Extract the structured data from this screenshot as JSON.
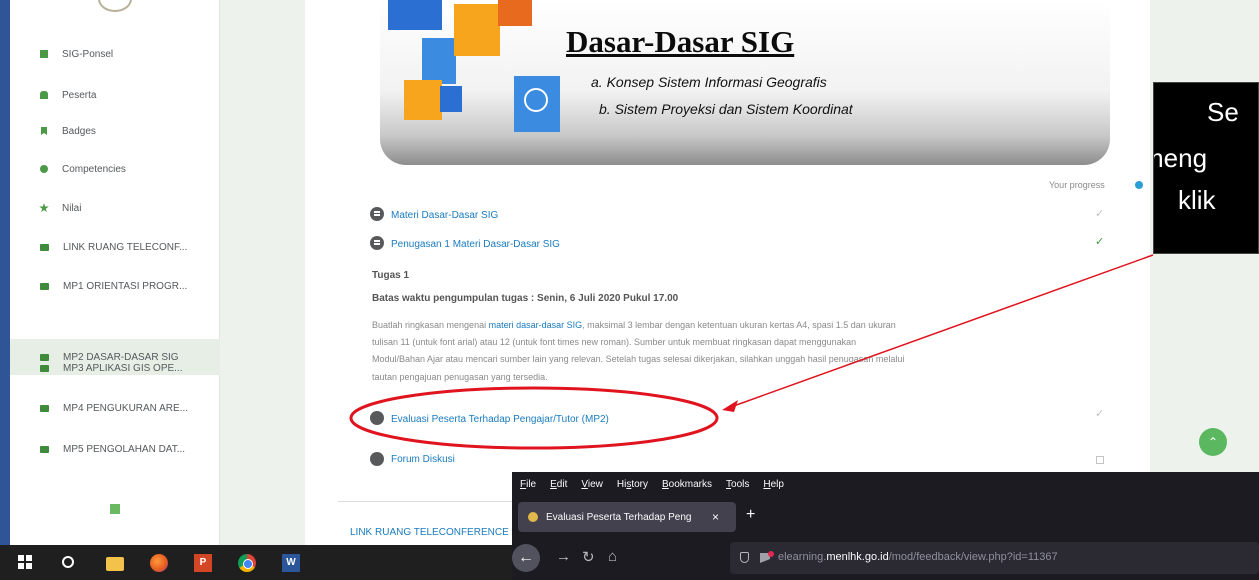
{
  "sidebar": {
    "items": [
      {
        "label": "SIG-Ponsel",
        "icon": "grid-icon"
      },
      {
        "label": "Peserta",
        "icon": "people-icon"
      },
      {
        "label": "Badges",
        "icon": "badge-flag-icon"
      },
      {
        "label": "Competencies",
        "icon": "competencies-icon"
      },
      {
        "label": "Nilai",
        "icon": "star-icon"
      },
      {
        "label": "LINK RUANG TELECONF...",
        "icon": "folder-icon"
      },
      {
        "label": "MP1 ORIENTASI PROGR...",
        "icon": "folder-icon"
      },
      {
        "label": "MP2 DASAR-DASAR SIG",
        "icon": "folder-icon",
        "active": true
      },
      {
        "label": "MP3 APLIKASI GIS OPE...",
        "icon": "folder-icon"
      },
      {
        "label": "MP4 PENGUKURAN ARE...",
        "icon": "folder-icon"
      },
      {
        "label": "MP5 PENGOLAHAN DAT...",
        "icon": "folder-icon"
      }
    ]
  },
  "banner": {
    "title": "Dasar-Dasar SIG",
    "line1": "a. Konsep Sistem Informasi Geografis",
    "line2": "b. Sistem Proyeksi dan Sistem Koordinat"
  },
  "course": {
    "progress_label": "Your progress",
    "activity1": "Materi Dasar-Dasar SIG",
    "activity2": "Penugasan 1 Materi Dasar-Dasar SIG",
    "task_title": "Tugas 1",
    "deadline": "Batas waktu pengumpulan tugas : Senin, 6 Juli 2020 Pukul 17.00",
    "desc": {
      "l1_pre": "Buatlah ringkasan mengenai ",
      "l1_link": "materi dasar-dasar SIG",
      "l1_post": ", maksimal 3 lembar dengan ketentuan ukuran kertas A4,  spasi 1.5 dan ukuran",
      "l2": "tulisan 11 (untuk font arial) atau 12 (untuk font times new roman). Sumber untuk membuat ringkasan dapat menggunakan",
      "l3": "Modul/Bahan Ajar atau mencari sumber lain yang relevan. Setelah tugas selesai dikerjakan, silahkan unggah hasil penugasan melalui",
      "l4": "tautan pengajuan penugasan yang tersedia."
    },
    "activity3": "Evaluasi Peserta Terhadap Pengajar/Tutor (MP2)",
    "activity4": "Forum Diskusi",
    "next_section": "LINK RUANG TELECONFERENCE"
  },
  "annotation": {
    "line1": "Se",
    "line2": "meng",
    "line3": "klik",
    "color": "#ff0000"
  },
  "firefox": {
    "menu": [
      {
        "u": "F",
        "rest": "ile"
      },
      {
        "u": "E",
        "rest": "dit"
      },
      {
        "u": "V",
        "rest": "iew"
      },
      {
        "pre": "Hi",
        "u": "s",
        "rest": "tory"
      },
      {
        "u": "B",
        "rest": "ookmarks"
      },
      {
        "u": "T",
        "rest": "ools"
      },
      {
        "u": "H",
        "rest": "elp"
      }
    ],
    "tab_title": "Evaluasi Peserta Terhadap Peng",
    "tab_close": "×",
    "new_tab": "+",
    "url_prefix": "elearning.",
    "url_domain": "menlhk.go.id",
    "url_path": "/mod/feedback/view.php?id=11367"
  },
  "taskbar": {
    "ppt_label": "P",
    "word_label": "W"
  },
  "colors": {
    "slide_bg": "#2f5597",
    "accent_green": "#4c9a48",
    "link_blue": "#1a7bbf",
    "annotation_red": "#ff0000"
  }
}
